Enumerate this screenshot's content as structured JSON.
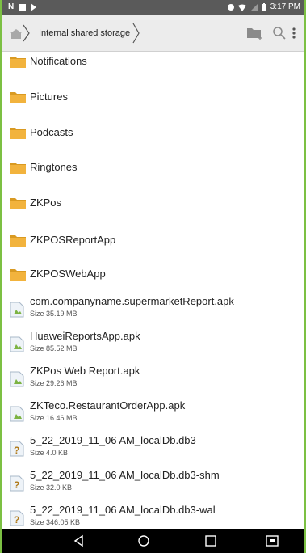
{
  "status_bar": {
    "time": "3:17 PM",
    "left_glyph": "N"
  },
  "toolbar": {
    "breadcrumb": "Internal shared storage",
    "icons": [
      "home-icon",
      "new-folder-icon",
      "search-icon",
      "more-vert-icon"
    ]
  },
  "folders": [
    {
      "name": "Notifications"
    },
    {
      "name": "Pictures"
    },
    {
      "name": "Podcasts"
    },
    {
      "name": "Ringtones"
    },
    {
      "name": "ZKPos"
    },
    {
      "name": "ZKPOSReportApp"
    },
    {
      "name": "ZKPOSWebApp"
    }
  ],
  "files": [
    {
      "name": "com.companyname.supermarketReport.apk",
      "size": "Size 35.19 MB",
      "type": "apk"
    },
    {
      "name": "HuaweiReportsApp.apk",
      "size": "Size 85.52 MB",
      "type": "apk"
    },
    {
      "name": "ZKPos Web Report.apk",
      "size": "Size 29.26 MB",
      "type": "apk"
    },
    {
      "name": "ZKTeco.RestaurantOrderApp.apk",
      "size": "Size 16.46 MB",
      "type": "apk"
    },
    {
      "name": "5_22_2019_11_06 AM_localDb.db3",
      "size": "Size 4.0 KB",
      "type": "unknown"
    },
    {
      "name": "5_22_2019_11_06 AM_localDb.db3-shm",
      "size": "Size 32.0 KB",
      "type": "unknown"
    },
    {
      "name": "5_22_2019_11_06 AM_localDb.db3-wal",
      "size": "Size 346.05 KB",
      "type": "unknown"
    }
  ],
  "nav_bar": {
    "buttons": [
      "back-icon",
      "home-circle-icon",
      "recents-icon",
      "keyboard-icon"
    ]
  },
  "colors": {
    "folder": "#f2b33d",
    "folder_dark": "#d99a22",
    "status_bar": "#5a5a5a",
    "toolbar": "#ececec",
    "frame_border": "#7cc043"
  }
}
